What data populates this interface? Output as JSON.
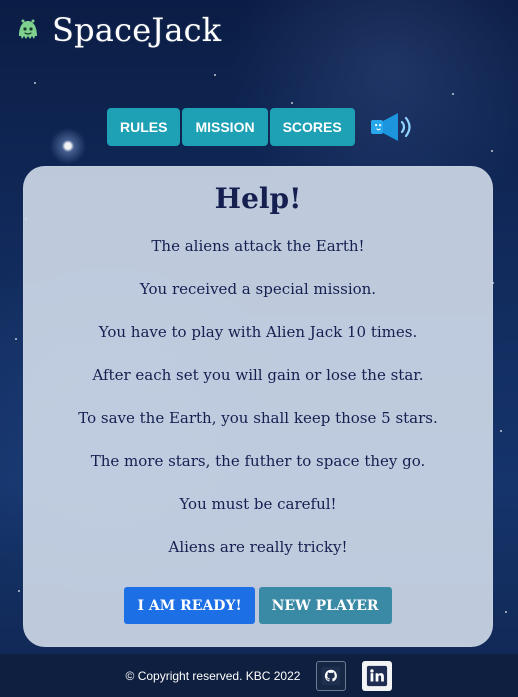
{
  "brand": {
    "name": "SpaceJack",
    "icon": "alien-icon"
  },
  "nav": {
    "items": [
      {
        "label": "RULES"
      },
      {
        "label": "MISSION"
      },
      {
        "label": "SCORES"
      }
    ],
    "sound_icon": "speaker-icon"
  },
  "help": {
    "title": "Help!",
    "lines": [
      "The aliens attack the Earth!",
      "You received a special mission.",
      "You have to play with Alien Jack 10 times.",
      "After each set you will gain or lose the star.",
      "To save the Earth, you shall keep those 5 stars.",
      "The more stars, the futher to space they go.",
      "You must be careful!",
      "Aliens are really tricky!"
    ],
    "buttons": {
      "ready": "I AM READY!",
      "new_player": "NEW PLAYER"
    }
  },
  "footer": {
    "text": "© Copyright reserved. KBC 2022",
    "icons": [
      "github-icon",
      "linkedin-icon"
    ]
  },
  "colors": {
    "accent": "#1ea0b5",
    "primary_button": "#1d6fe6",
    "secondary_button": "#3a8aa6",
    "text_dark": "#151f50"
  }
}
